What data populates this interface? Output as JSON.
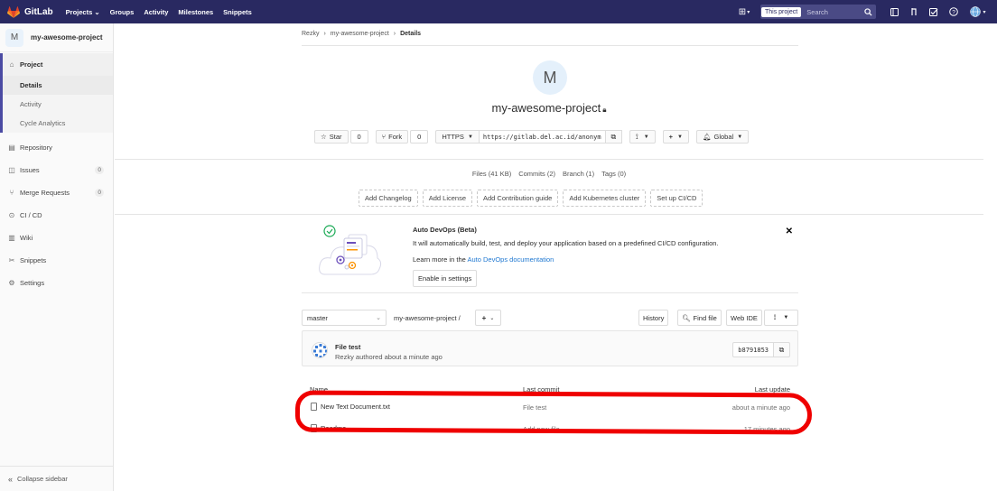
{
  "navbar": {
    "brand": "GitLab",
    "links": [
      "Projects ⌄",
      "Groups",
      "Activity",
      "Milestones",
      "Snippets"
    ],
    "search_scope": "This project",
    "search_placeholder": "Search",
    "accent": "#292961"
  },
  "sidebar": {
    "project_avatar": "M",
    "project_name": "my-awesome-project",
    "project_label": "Project",
    "sub_items": [
      "Details",
      "Activity",
      "Cycle Analytics"
    ],
    "items": [
      {
        "label": "Repository",
        "icon": "book-icon"
      },
      {
        "label": "Issues",
        "icon": "issues-icon",
        "count": "0"
      },
      {
        "label": "Merge Requests",
        "icon": "merge-request-icon",
        "count": "0"
      },
      {
        "label": "CI / CD",
        "icon": "rocket-icon"
      },
      {
        "label": "Wiki",
        "icon": "book-open-icon"
      },
      {
        "label": "Snippets",
        "icon": "scissors-icon"
      },
      {
        "label": "Settings",
        "icon": "gear-icon"
      }
    ],
    "collapse_label": "Collapse sidebar"
  },
  "breadcrumb": {
    "items": [
      "Rezky",
      "my-awesome-project"
    ],
    "current": "Details"
  },
  "project": {
    "avatar": "M",
    "title": "my-awesome-project",
    "star_label": "Star",
    "star_count": "0",
    "fork_label": "Fork",
    "fork_count": "0",
    "protocol": "HTTPS",
    "clone_url": "https://gitlab.del.ac.id/anonym",
    "notification": "Global"
  },
  "stats": {
    "files": "Files (41 KB)",
    "commits": "Commits (2)",
    "branch": "Branch (1)",
    "tags": "Tags (0)"
  },
  "add_buttons": [
    "Add Changelog",
    "Add License",
    "Add Contribution guide",
    "Add Kubernetes cluster",
    "Set up CI/CD"
  ],
  "devops": {
    "title": "Auto DevOps (Beta)",
    "description": "It will automatically build, test, and deploy your application based on a predefined CI/CD configuration.",
    "learn_prefix": "Learn more in the",
    "learn_link": "Auto DevOps documentation",
    "enable_label": "Enable in settings"
  },
  "repo": {
    "branch": "master",
    "path": "my-awesome-project  /",
    "history": "History",
    "find_file": "Find file",
    "web_ide": "Web IDE"
  },
  "commit": {
    "title": "File test",
    "meta": "Rezky authored about a minute ago",
    "sha": "b8791853"
  },
  "table": {
    "headers": {
      "name": "Name",
      "last_commit": "Last commit",
      "last_update": "Last update"
    },
    "rows": [
      {
        "name": "New Text Document.txt",
        "commit": "File test",
        "updated": "about a minute ago"
      },
      {
        "name": "Readme",
        "commit": "Add new file",
        "updated": "17 minutes ago"
      }
    ]
  },
  "highlight_color": "#ef0000"
}
